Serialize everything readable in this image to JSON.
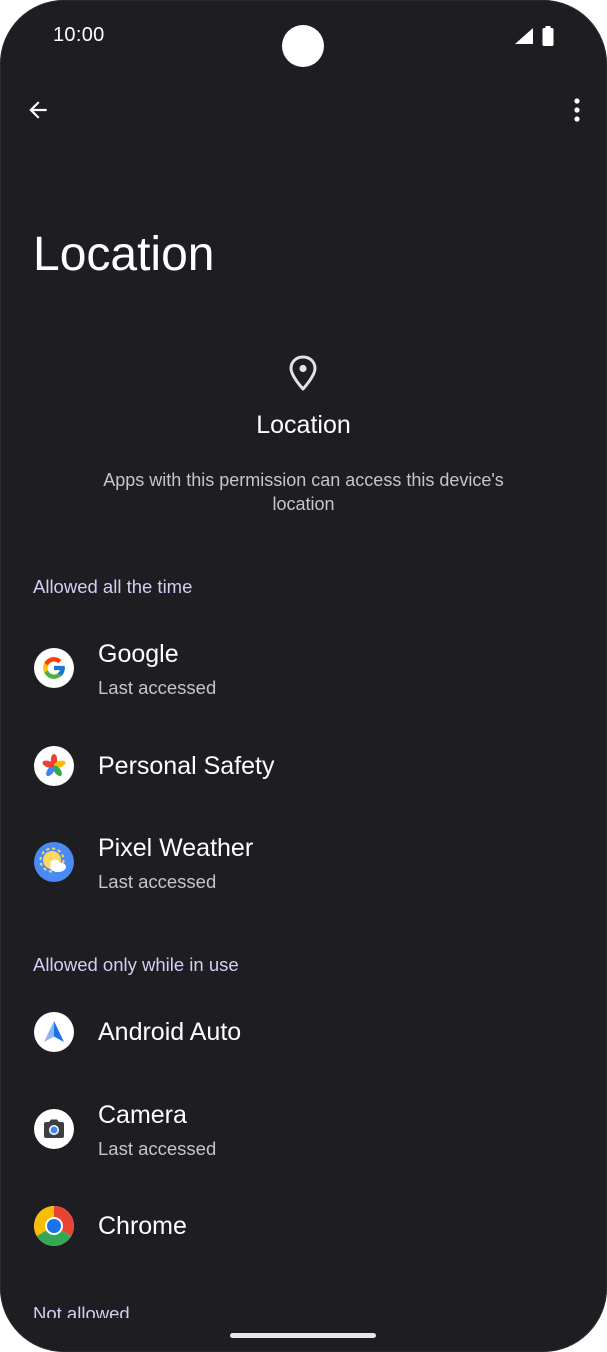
{
  "status_bar": {
    "time": "10:00"
  },
  "page": {
    "title": "Location"
  },
  "header": {
    "icon": "location-pin-icon",
    "title": "Location",
    "description": "Apps with this permission can access this device's location"
  },
  "sections": {
    "allowed_all": {
      "label": "Allowed all the time",
      "apps": [
        {
          "name": "Google",
          "subtitle": "Last accessed",
          "icon": "google-icon"
        },
        {
          "name": "Personal Safety",
          "icon": "personal-safety-icon"
        },
        {
          "name": "Pixel Weather",
          "subtitle": "Last accessed",
          "icon": "pixel-weather-icon"
        }
      ]
    },
    "allowed_in_use": {
      "label": "Allowed only while in use",
      "apps": [
        {
          "name": "Android Auto",
          "icon": "android-auto-icon"
        },
        {
          "name": "Camera",
          "subtitle": "Last accessed",
          "icon": "camera-icon"
        },
        {
          "name": "Chrome",
          "icon": "chrome-icon"
        }
      ]
    },
    "not_allowed": {
      "label": "Not allowed"
    }
  },
  "colors": {
    "background": "#1e1d22",
    "section_header": "#d8ccf4",
    "secondary_text": "#c7c5cc"
  }
}
